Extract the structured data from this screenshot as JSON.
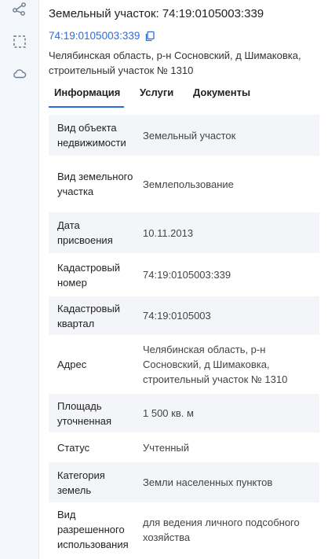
{
  "toolbar": {
    "tools": [
      {
        "icon": "route-icon"
      },
      {
        "icon": "select-area-icon"
      },
      {
        "icon": "cloud-icon"
      }
    ]
  },
  "header": {
    "title": "Земельный участок: 74:19:0105003:339",
    "cadastral_number": "74:19:0105003:339",
    "address": "Челябинская область, р-н Сосновский, д Шимаковка, строительный участок № 1310"
  },
  "tabs": [
    {
      "label": "Информация",
      "active": true
    },
    {
      "label": "Услуги",
      "active": false
    },
    {
      "label": "Документы",
      "active": false
    }
  ],
  "properties": [
    {
      "label": "Вид объекта недвижимости",
      "value": "Земельный участок"
    },
    {
      "label": "Вид земельного участка",
      "value": "Землепользование"
    },
    {
      "label": "Дата присвоения",
      "value": "10.11.2013"
    },
    {
      "label": "Кадастровый номер",
      "value": "74:19:0105003:339"
    },
    {
      "label": "Кадастровый квартал",
      "value": "74:19:0105003"
    },
    {
      "label": "Адрес",
      "value": "Челябинская область, р-н Сосновский, д Шимаковка, строительный участок № 1310"
    },
    {
      "label": "Площадь уточненная",
      "value": "1 500 кв. м"
    },
    {
      "label": "Статус",
      "value": "Учтенный"
    },
    {
      "label": "Категория земель",
      "value": "Земли населенных пунктов"
    },
    {
      "label": "Вид разрешенного использования",
      "value": "для ведения личного подсобного хозяйства"
    }
  ],
  "colors": {
    "accent": "#2d6cdf",
    "row_alt": "#f3f5f8",
    "toolbar_bg": "#f3f6fa"
  }
}
